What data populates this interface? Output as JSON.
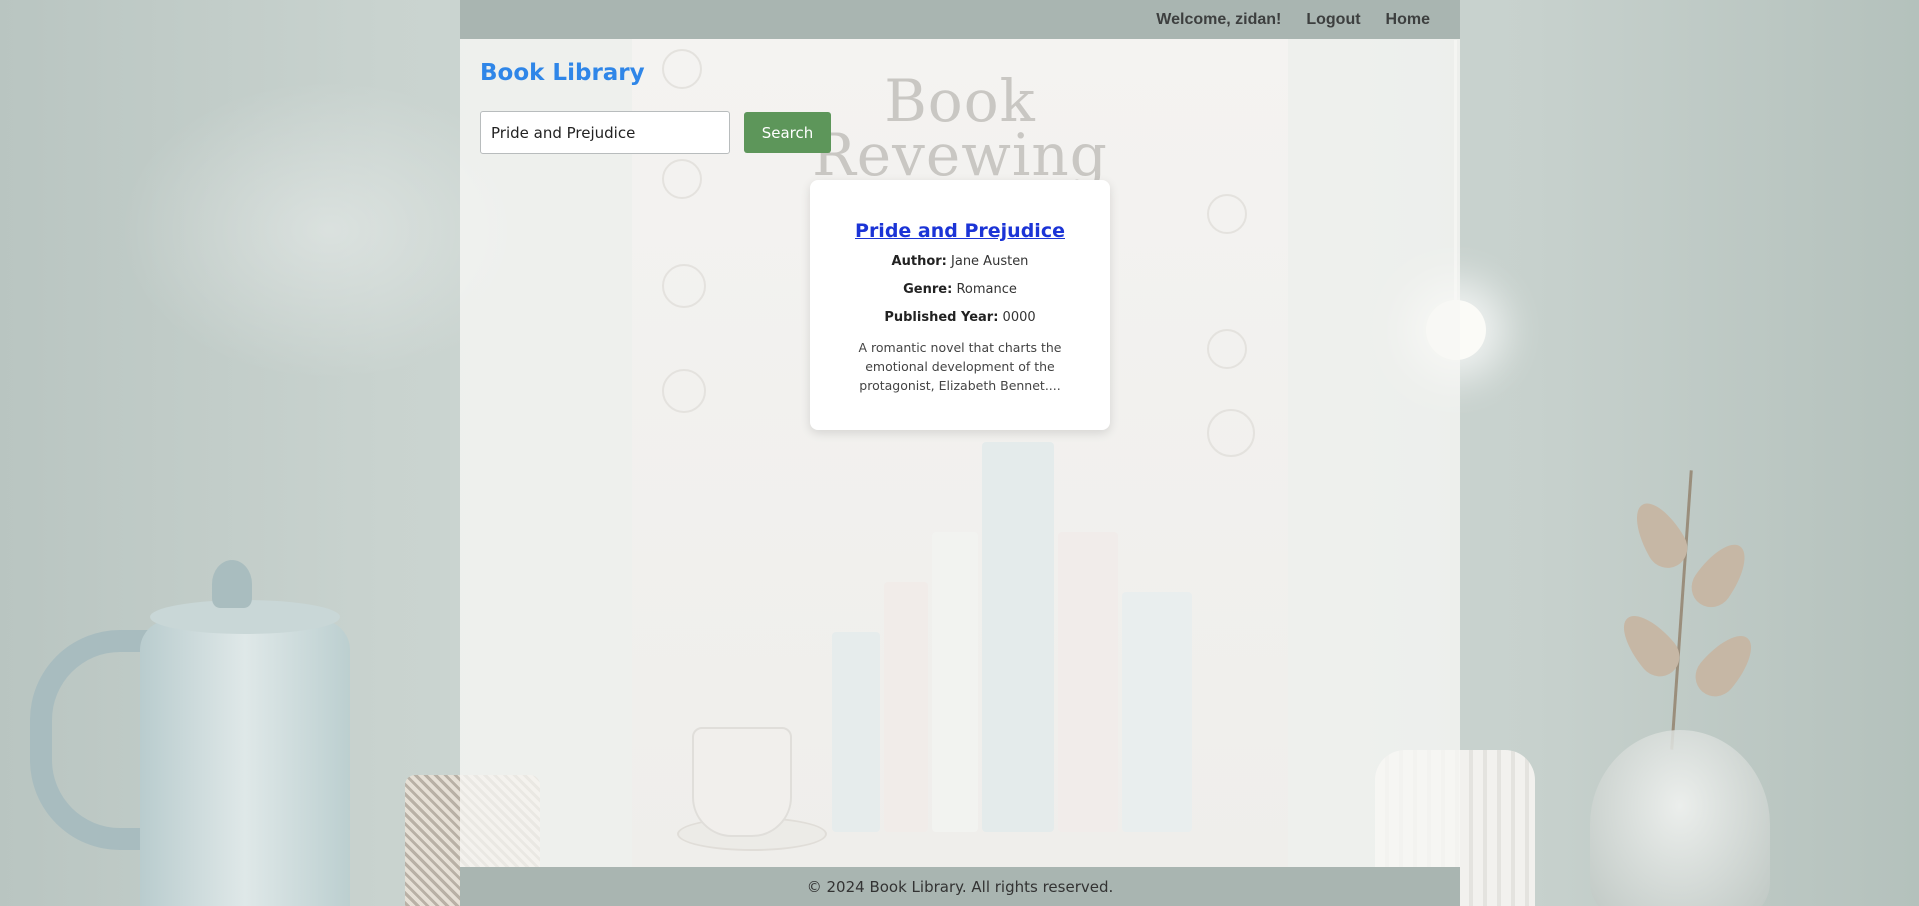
{
  "header": {
    "welcome": "Welcome, zidan!",
    "logout_label": "Logout",
    "home_label": "Home"
  },
  "brand": {
    "title": "Book Library"
  },
  "search": {
    "value": "Pride and Prejudice",
    "button_label": "Search"
  },
  "poster": {
    "title_line1": "Book",
    "title_line2": "Revewing"
  },
  "results": [
    {
      "title": "Pride and Prejudice",
      "author_label": "Author:",
      "author": "Jane Austen",
      "genre_label": "Genre:",
      "genre": "Romance",
      "year_label": "Published Year:",
      "year": "0000",
      "description": "A romantic novel that charts the emotional development of the protagonist, Elizabeth Bennet...."
    }
  ],
  "footer": {
    "text": "© 2024 Book Library. All rights reserved."
  },
  "colors": {
    "brand": "#2f86e8",
    "search_button": "#5d965a",
    "bar": "#a9b5b1",
    "link": "#1b34d6"
  }
}
